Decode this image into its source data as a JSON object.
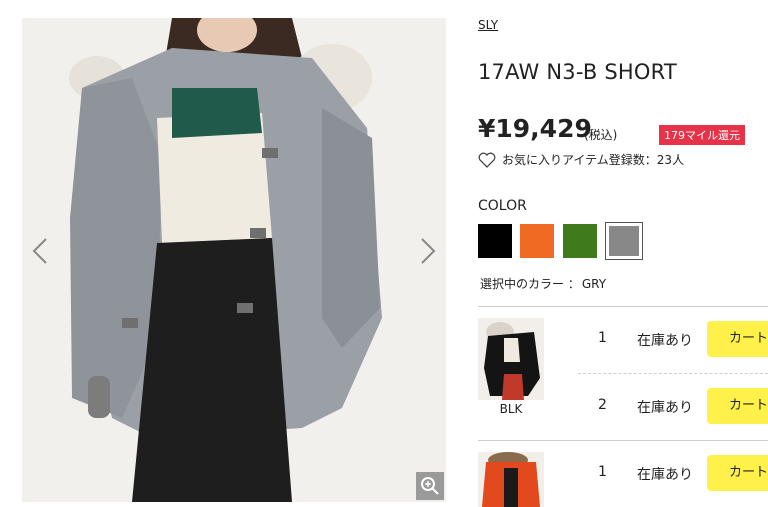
{
  "brand": "SLY",
  "product_title": "17AW N3-B SHORT",
  "price": "¥19,429",
  "tax_note": "(税込)",
  "mile_badge": "179マイル還元",
  "favorite_text": "お気に入りアイテム登録数：23人",
  "color_section": {
    "heading": "COLOR",
    "swatches": [
      {
        "name": "black",
        "color": "#000000"
      },
      {
        "name": "orange",
        "color": "#f06a24"
      },
      {
        "name": "green",
        "color": "#3f7a1c"
      },
      {
        "name": "gray",
        "color": "#888888",
        "selected": true
      }
    ],
    "selected_label": "選択中のカラー ：",
    "selected_value": "GRY"
  },
  "variants": [
    {
      "color_label": "BLK",
      "rows": [
        {
          "size": "1",
          "stock": "在庫あり",
          "cart": "カート"
        },
        {
          "size": "2",
          "stock": "在庫あり",
          "cart": "カート"
        }
      ]
    },
    {
      "color_label": "",
      "rows": [
        {
          "size": "1",
          "stock": "在庫あり",
          "cart": "カート"
        }
      ]
    }
  ],
  "icons": [
    "chevron-left-icon",
    "chevron-right-icon",
    "zoom-icon",
    "heart-icon"
  ]
}
